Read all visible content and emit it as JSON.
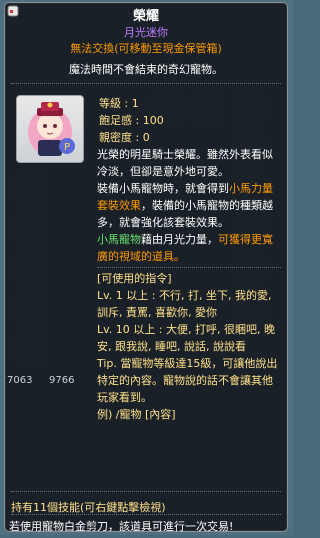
{
  "header": {
    "title": "榮耀",
    "subtitle": "月光迷你",
    "trade_notice": "無法交換(可移動至現金保管箱)",
    "description": "魔法時間不會結束的奇幻寵物。"
  },
  "stats": {
    "level_label": "等級",
    "level_value": "1",
    "fullness_label": "飽足感",
    "fullness_value": "100",
    "affinity_label": "親密度",
    "affinity_value": "0"
  },
  "body": {
    "para1": "光榮的明星騎士榮耀。雖然外表看似冷淡，但卻是意外地可愛。",
    "para2_a": "裝備小馬寵物時，就會得到",
    "para2_b": "小馬力量套裝效果",
    "para2_c": "，裝備的小馬寵物的種類越多，就會強化該套裝效果。",
    "para3_a": "小馬寵物",
    "para3_b": "藉由月光力量，",
    "para3_c": "可獲得更寬廣的視域的道具。",
    "cmd_header": "[可使用的指令]",
    "cmd1_a": "Lv. 1 以上 : 不行, 打, 坐下, 我的愛, 訓斥, 責罵, 喜歡你, 愛你",
    "cmd2_a": "Lv. 10 以上 : 大便, 打呼, 很睏吧, 晚安, 跟我說, 睡吧, 說話, 說說看",
    "tip": "Tip. 當寵物等級達15級，可讓他說出特定的內容。寵物說的話不會讓其他玩家看到。",
    "example": "例) /寵物 [內容]"
  },
  "footer": {
    "skills": "持有11個技能(可右鍵點擊檢視)",
    "notice": "若使用寵物白金剪刀，該道具可進行一次交易!"
  },
  "ghost": {
    "n1": "7063",
    "n2": "9766"
  },
  "colors": {
    "title": "#ffffff",
    "subtitle": "#c07cff",
    "orange": "#ff9a00",
    "green": "#69e06e",
    "yellow": "#ffe08a"
  },
  "icons": [
    "pet-portrait-icon",
    "window-icon"
  ]
}
